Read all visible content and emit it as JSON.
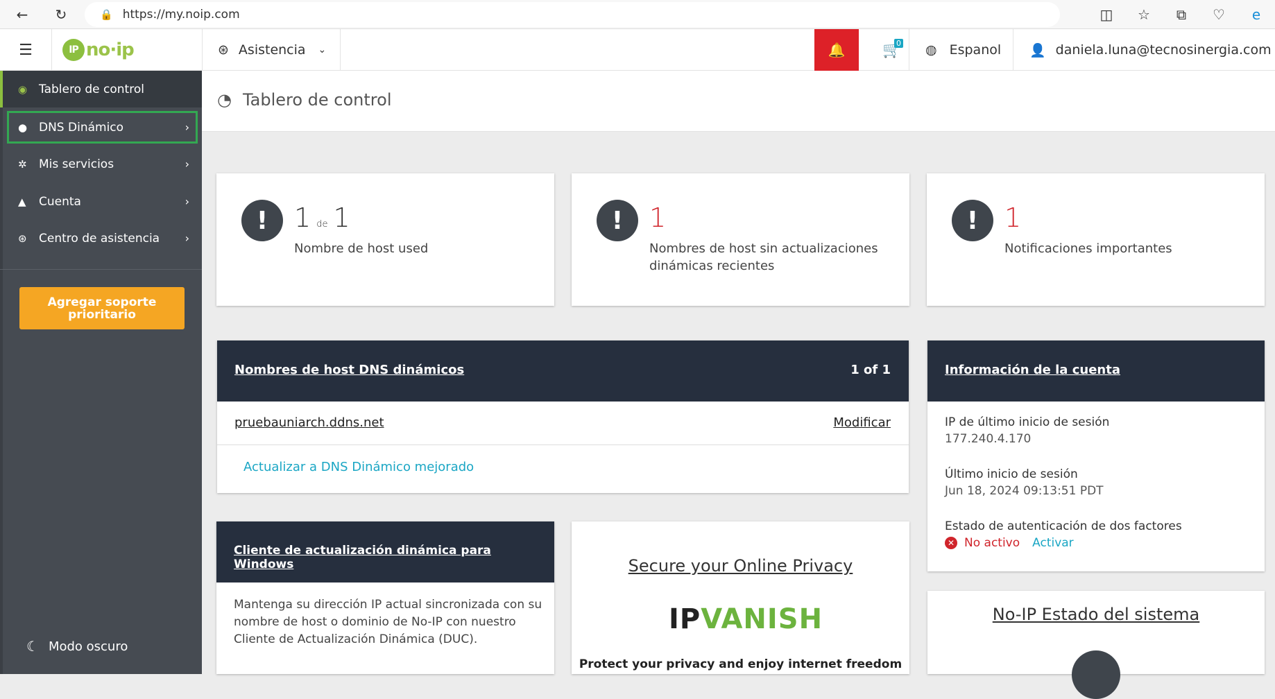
{
  "browser": {
    "url": "https://my.noip.com"
  },
  "header": {
    "logo_text": "no·ip",
    "assist_label": "Asistencia",
    "cart_count": "0",
    "language": "Espanol",
    "user_email": "daniela.luna@tecnosinergia.com"
  },
  "sidebar": {
    "items": [
      {
        "label": "Tablero de control",
        "icon": "dashboard-icon"
      },
      {
        "label": "DNS Dinámico",
        "icon": "globe-icon"
      },
      {
        "label": "Mis servicios",
        "icon": "gear-icon"
      },
      {
        "label": "Cuenta",
        "icon": "user-icon"
      },
      {
        "label": "Centro de asistencia",
        "icon": "lifebuoy-icon"
      }
    ],
    "annotation": "1",
    "priority_button": "Agregar soporte prioritario",
    "dark_mode": "Modo oscuro"
  },
  "main": {
    "page_title": "Tablero de control",
    "stats": [
      {
        "value": "1",
        "of": "de",
        "total": "1",
        "label": "Nombre de host used"
      },
      {
        "value": "1",
        "label": "Nombres de host sin actualizaciones dinámicas recientes"
      },
      {
        "value": "1",
        "label": "Notificaciones importantes"
      }
    ],
    "hosts": {
      "title": "Nombres de host DNS dinámicos",
      "count": "1 of 1",
      "host": "pruebauniarch.ddns.net",
      "modify": "Modificar",
      "upgrade": "Actualizar a DNS Dinámico mejorado"
    },
    "account": {
      "title": "Información de la cuenta",
      "last_ip_label": "IP de último inicio de sesión",
      "last_ip": "177.240.4.170",
      "last_login_label": "Último inicio de sesión",
      "last_login": "Jun 18, 2024 09:13:51 PDT",
      "two_factor_label": "Estado de autenticación de dos factores",
      "two_factor_status": "No activo",
      "activate": "Activar"
    },
    "duc": {
      "title": "Cliente de actualización dinámica para Windows",
      "text": "Mantenga su dirección IP actual sincronizada con su nombre de host o dominio de No-IP con nuestro Cliente de Actualización Dinámica (DUC)."
    },
    "ipvanish": {
      "title": "Secure your Online Privacy",
      "logo_ip": "IP",
      "logo_vanish": "VANISH",
      "text": "Protect your privacy and enjoy internet freedom"
    },
    "status": {
      "title": "No-IP Estado del sistema"
    }
  },
  "colors": {
    "accent_green": "#8cbf3f",
    "alert_red": "#d0242b",
    "teal": "#1aa6c4",
    "priority_orange": "#f5a623",
    "dark_panel": "#262f3e"
  }
}
